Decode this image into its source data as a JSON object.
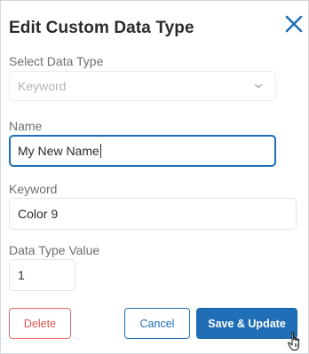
{
  "dialog": {
    "title": "Edit Custom Data Type",
    "close_icon": "close-icon"
  },
  "form": {
    "select_data_type": {
      "label": "Select Data Type",
      "value": "Keyword",
      "disabled": true,
      "icon": "chevron-down-icon"
    },
    "name": {
      "label": "Name",
      "value": "My New Name",
      "focused": true
    },
    "keyword": {
      "label": "Keyword",
      "value": "Color 9"
    },
    "data_type_value": {
      "label": "Data Type Value",
      "value": "1"
    }
  },
  "actions": {
    "delete_label": "Delete",
    "cancel_label": "Cancel",
    "save_label": "Save & Update"
  },
  "colors": {
    "accent": "#1f6eb6",
    "danger": "#d9534f"
  },
  "cursor_icon": "hand-pointer-icon"
}
